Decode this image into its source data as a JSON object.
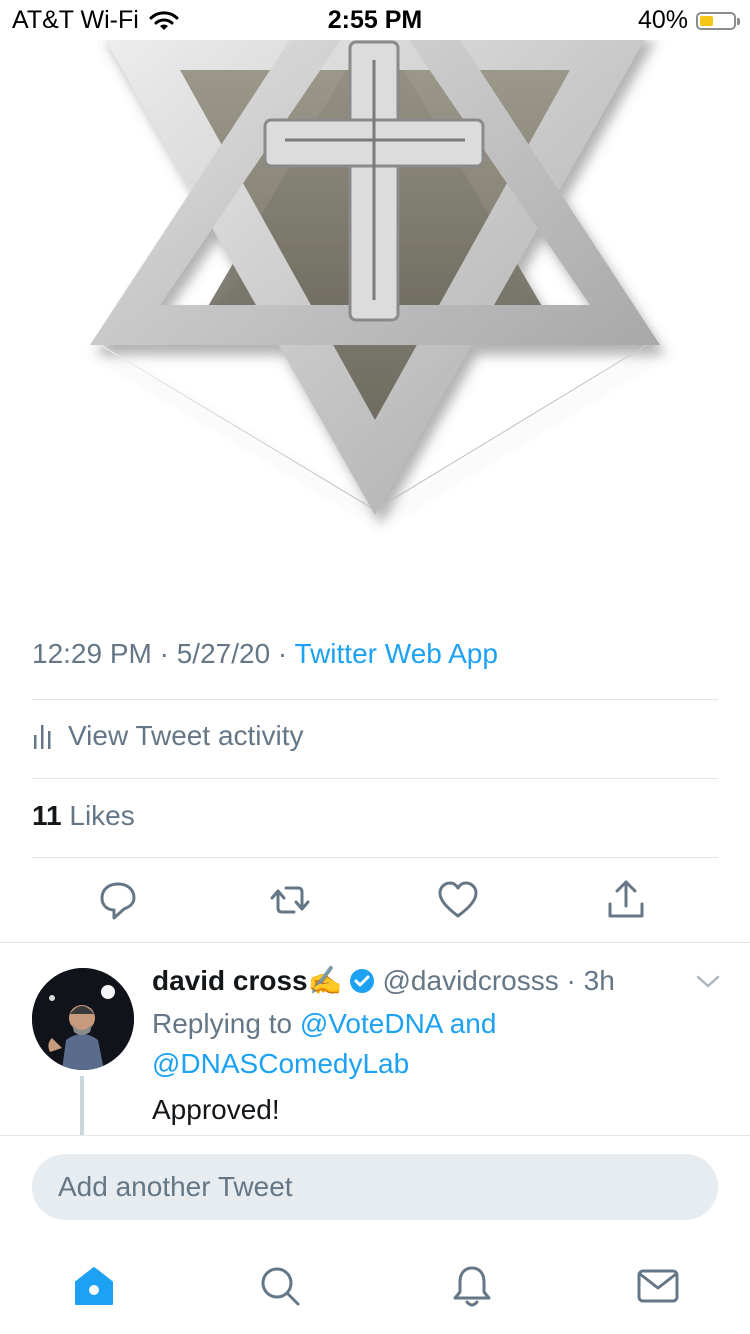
{
  "status_bar": {
    "carrier": "AT&T Wi-Fi",
    "time": "2:55 PM",
    "battery": "40%",
    "battery_level": 0.4
  },
  "tweet": {
    "timestamp": "12:29 PM · 5/27/20 · ",
    "source": "Twitter Web App",
    "activity_label": "View Tweet activity",
    "likes_count": "11",
    "likes_label": " Likes"
  },
  "reply": {
    "name": "david cross✍️",
    "handle": "@davidcrosss · 3h",
    "replying_prefix": "Replying to ",
    "mention_1": "@VoteDNA",
    "and": " and ",
    "mention_2": "@DNASComedyLab",
    "text": "Approved!"
  },
  "compose": {
    "placeholder": "Add another Tweet"
  },
  "colors": {
    "accent": "#1da1f2",
    "secondary_text": "#657786",
    "divider": "#e1e8ed"
  },
  "icons": [
    "wifi-icon",
    "battery-icon",
    "reply-icon",
    "retweet-icon",
    "like-icon",
    "share-icon",
    "verified-badge-icon",
    "chevron-down-icon",
    "home-icon",
    "search-icon",
    "notifications-icon",
    "messages-icon"
  ]
}
